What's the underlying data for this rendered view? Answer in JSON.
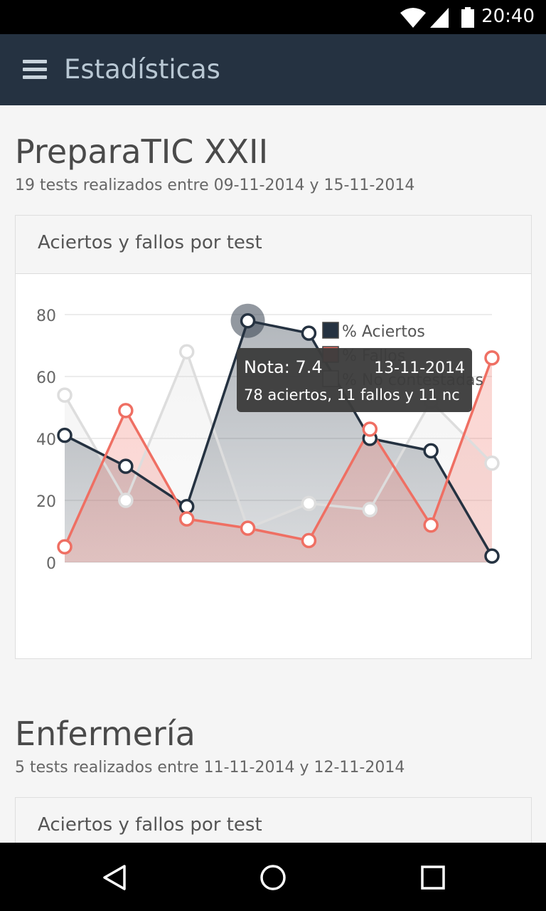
{
  "statusbar": {
    "time": "20:40"
  },
  "appbar": {
    "title": "Estadísticas"
  },
  "sections": [
    {
      "title": "PreparaTIC XXII",
      "subtitle": "19 tests realizados entre 09-11-2014 y 15-11-2014",
      "panel_title": "Aciertos y fallos por test"
    },
    {
      "title": "Enfermería",
      "subtitle": "5 tests realizados entre 11-11-2014 y 12-11-2014",
      "panel_title": "Aciertos y fallos por test"
    }
  ],
  "tooltip": {
    "nota": "Nota: 7.4",
    "date": "13-11-2014",
    "detail": "78 aciertos, 11 fallos y 11 nc"
  },
  "chart_data": {
    "type": "line",
    "x": [
      1,
      2,
      3,
      4,
      5,
      6,
      7,
      8
    ],
    "ylim": [
      0,
      80
    ],
    "yticks": [
      "0",
      "20",
      "40",
      "60",
      "80"
    ],
    "grid": true,
    "legend_position": "top-right",
    "series": [
      {
        "name": "% Aciertos",
        "color": "#253241",
        "values": [
          41,
          31,
          18,
          78,
          74,
          40,
          36,
          2
        ]
      },
      {
        "name": "% Fallos",
        "color": "#ef6f63",
        "values": [
          5,
          49,
          14,
          11,
          7,
          43,
          12,
          66
        ]
      },
      {
        "name": "% No contestadas",
        "color": "#dddddd",
        "values": [
          54,
          20,
          68,
          11,
          19,
          17,
          52,
          32
        ]
      }
    ],
    "highlight_index": 3
  }
}
